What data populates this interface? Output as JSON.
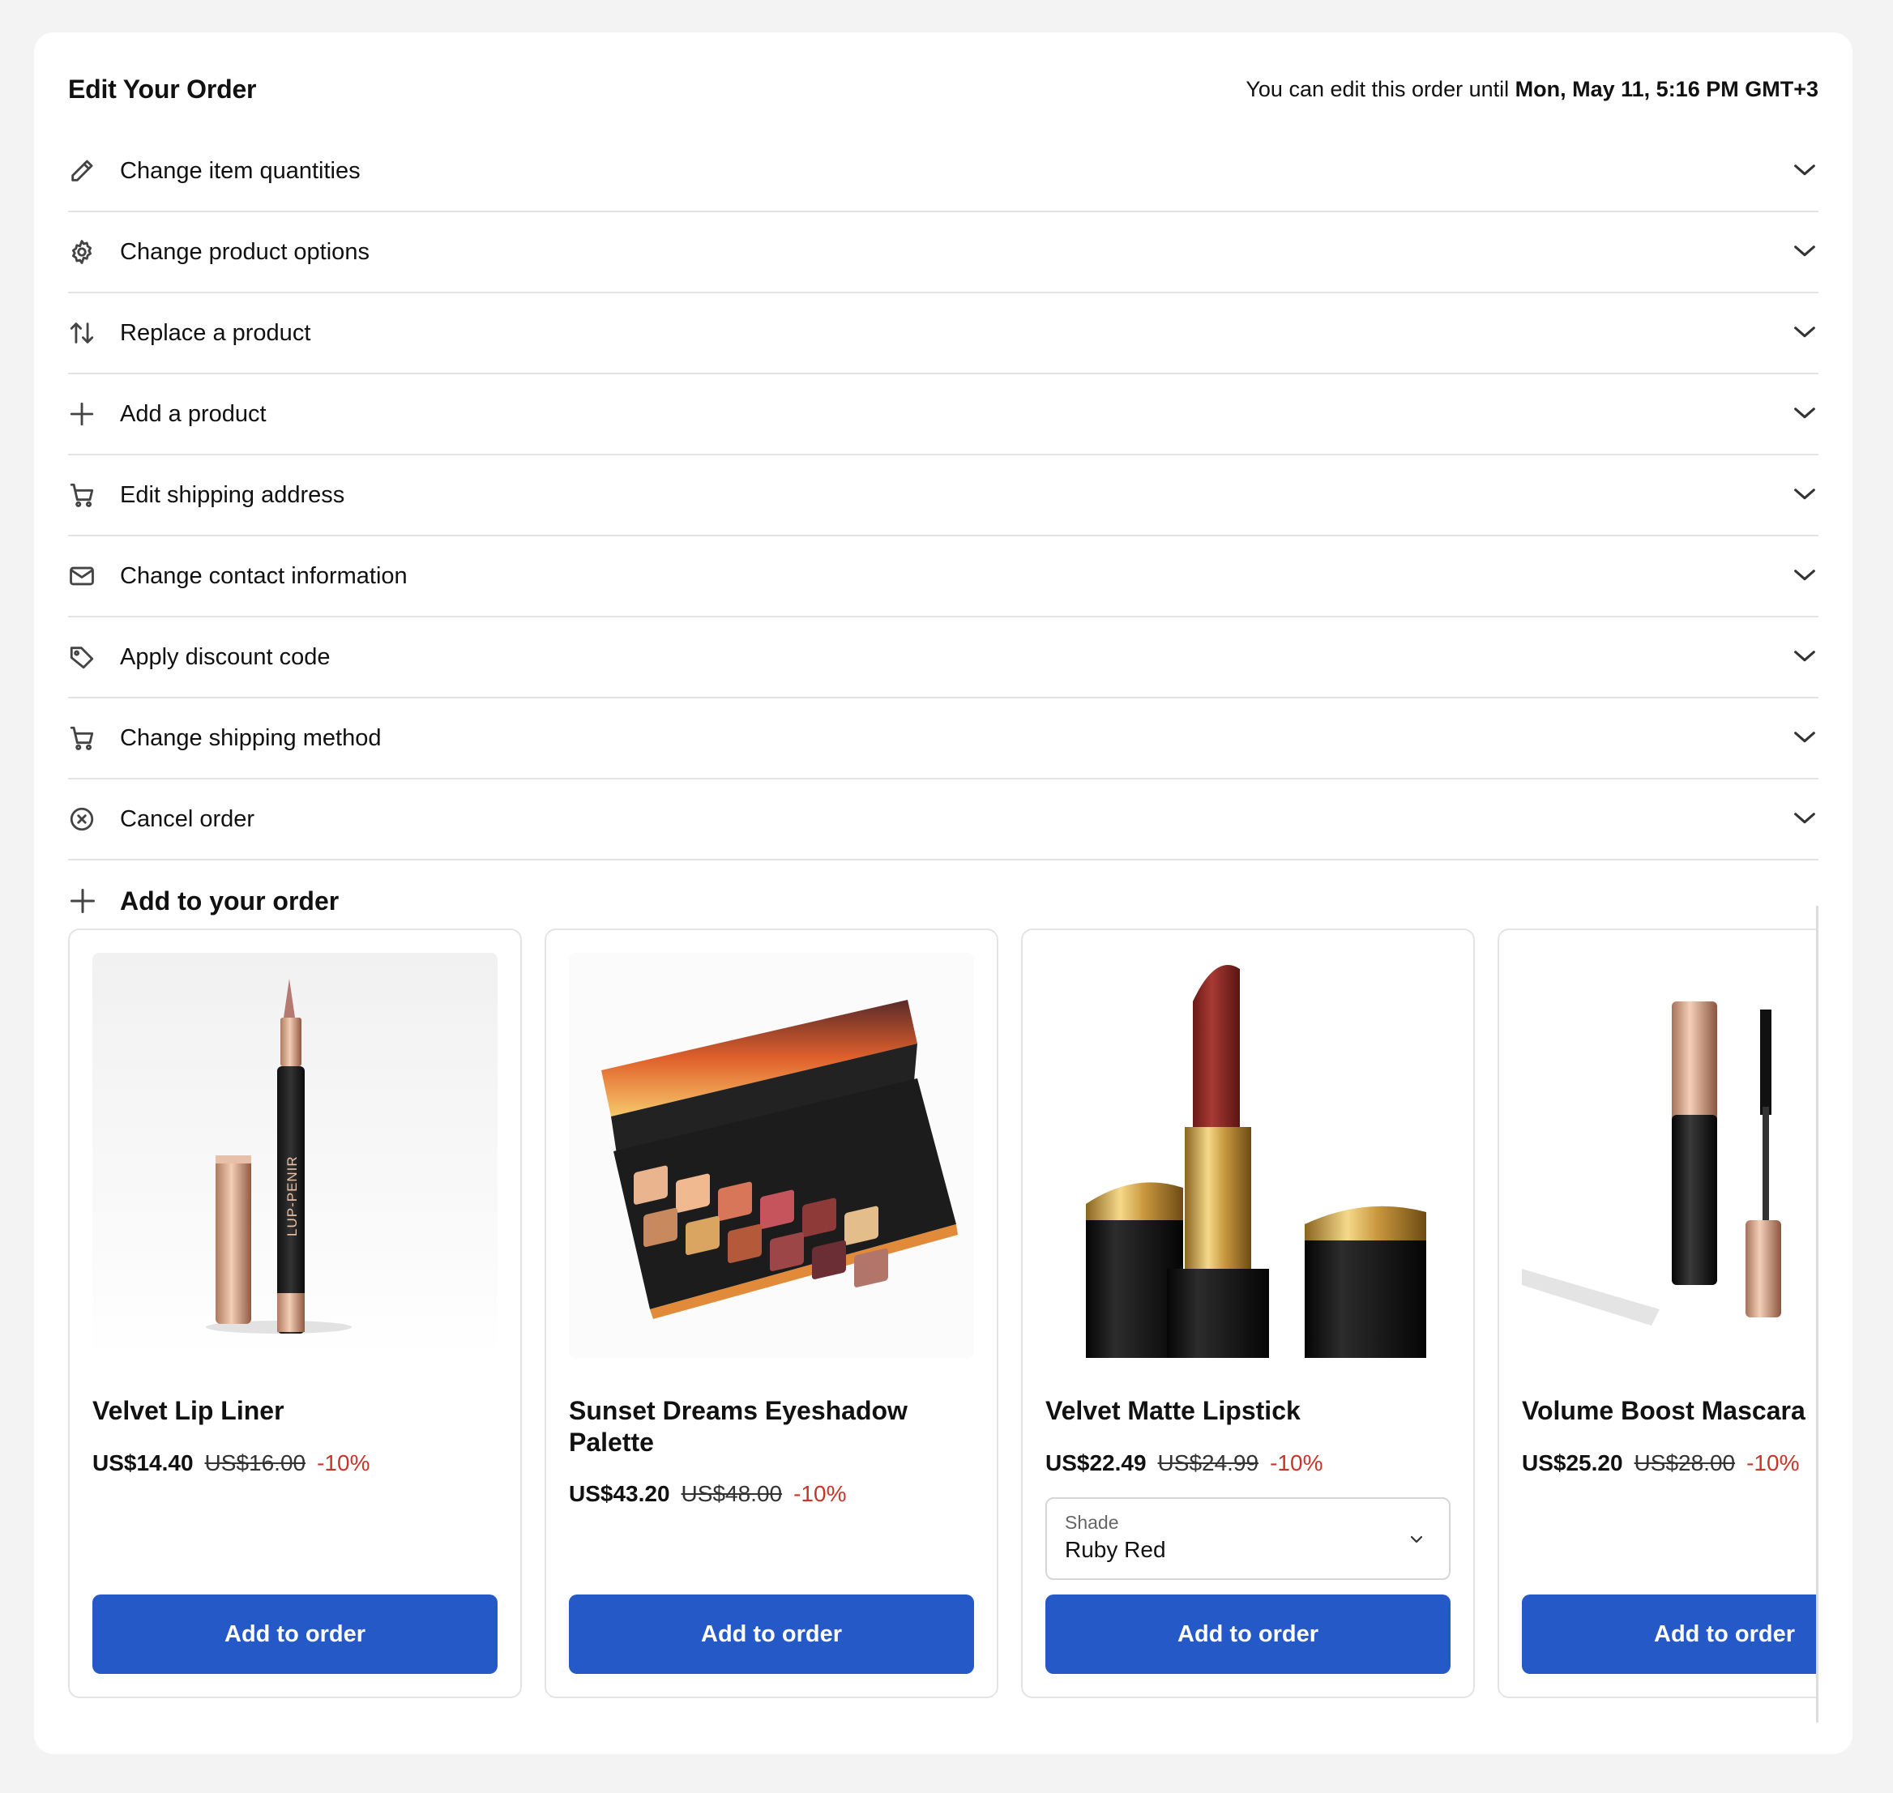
{
  "header": {
    "title": "Edit Your Order",
    "deadline_prefix": "You can edit this order until",
    "deadline_value": "Mon, May 11, 5:16 PM GMT+3"
  },
  "actions": [
    {
      "label": "Change item quantities",
      "icon": "pencil-icon"
    },
    {
      "label": "Change product options",
      "icon": "gear-icon"
    },
    {
      "label": "Replace a product",
      "icon": "swap-arrows-icon"
    },
    {
      "label": "Add a product",
      "icon": "plus-icon"
    },
    {
      "label": "Edit shipping address",
      "icon": "cart-icon"
    },
    {
      "label": "Change contact information",
      "icon": "envelope-icon"
    },
    {
      "label": "Apply discount code",
      "icon": "tag-icon"
    },
    {
      "label": "Change shipping method",
      "icon": "cart-icon"
    },
    {
      "label": "Cancel order",
      "icon": "cancel-circle-icon"
    }
  ],
  "upsell": {
    "title": "Add to your order",
    "products": [
      {
        "name": "Velvet Lip Liner",
        "price": "US$14.40",
        "original_price": "US$16.00",
        "discount": "-10%",
        "button": "Add to order",
        "image_label": "LUP-PENIR"
      },
      {
        "name": "Sunset Dreams Eyeshadow Palette",
        "price": "US$43.20",
        "original_price": "US$48.00",
        "discount": "-10%",
        "button": "Add to order"
      },
      {
        "name": "Velvet Matte Lipstick",
        "price": "US$22.49",
        "original_price": "US$24.99",
        "discount": "-10%",
        "button": "Add to order",
        "option": {
          "label": "Shade",
          "value": "Ruby Red"
        }
      },
      {
        "name": "Volume Boost Mascara",
        "price": "US$25.20",
        "original_price": "US$28.00",
        "discount": "-10%",
        "button": "Add to order"
      }
    ]
  },
  "colors": {
    "primary_button": "#2459c7",
    "discount": "#c8362b",
    "page_background": "#f3f3f3"
  }
}
